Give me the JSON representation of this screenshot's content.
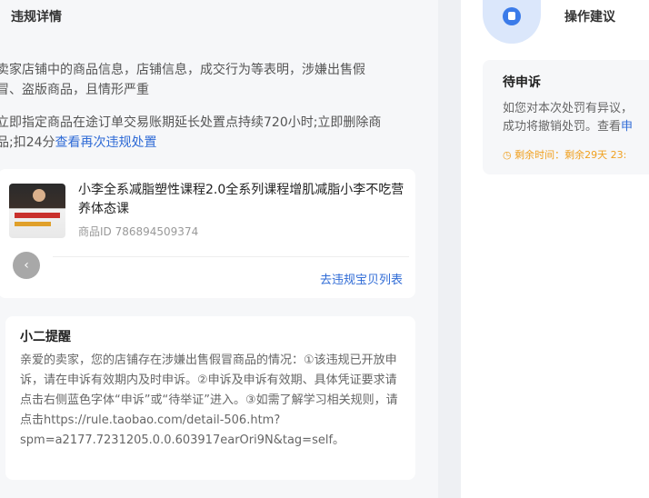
{
  "left": {
    "title": "违规详情",
    "para1": "卖家店铺中的商品信息，店铺信息，成交行为等表明，涉嫌出售假\n冒、盗版商品，且情形严重",
    "para2_text": "立即指定商品在途订单交易账期延长处置点持续720小时;立即删除商\n品;扣24分",
    "para2_link": "查看再次违规处置",
    "product": {
      "title": "小李全系减脂塑性课程2.0全系列课程增肌减脂小李不吃营养体态课",
      "id_text": "商品ID 786894509374",
      "prev_icon": "chevron-left-icon",
      "link": "去违规宝贝列表"
    },
    "tips": {
      "title": "小二提醒",
      "body": "亲爱的卖家，您的店铺存在涉嫌出售假冒商品的情况：①该违规已开放申诉，请在申诉有效期内及时申诉。②申诉及申诉有效期、具体凭证要求请点击右侧蓝色字体“申诉”或“待举证”进入。③如需了解学习相关规则，请点击https://rule.taobao.com/detail-506.htm?spm=a2177.7231205.0.0.603917earOri9N&tag=self。"
    }
  },
  "right": {
    "title": "操作建议",
    "icon": "lightbulb-icon",
    "pending": {
      "title": "待申诉",
      "body1": "如您对本次处罚有异议，",
      "body2_text": "成功将撤销处罚。查看",
      "body2_link": "申",
      "remaining": "剩余时间：剩余29天 23:",
      "clock_icon": "clock-icon"
    }
  },
  "colors": {
    "link": "#2f6bd6",
    "warning": "#f0a020",
    "background": "#eef0f3"
  }
}
